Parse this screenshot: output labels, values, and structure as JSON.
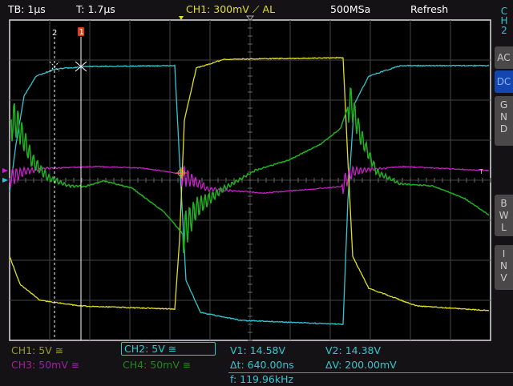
{
  "header": {
    "timebase": "TB: 1µs",
    "trigger_time": "T: 1.7µs",
    "trigger_info": "CH1: 300mV ⟋ AL",
    "sample_rate": "500MSa",
    "mode": "Refresh"
  },
  "side_panel": {
    "channel_label": [
      "C",
      "H",
      "2"
    ],
    "buttons": [
      {
        "label": "AC"
      },
      {
        "label": "DC",
        "active": true
      },
      {
        "label": "G\nN\nD"
      },
      {
        "label": "B\nW\nL"
      },
      {
        "label": "I\nN\nV"
      }
    ]
  },
  "cursors": {
    "cursor1_label": "1",
    "cursor2_label": "2",
    "trigger_marker": "T"
  },
  "channels": {
    "ch1": "CH1: 5V ≅",
    "ch2": "CH2: 5V ≅",
    "ch3": "CH3: 50mV ≅",
    "ch4": "CH4: 50mV ≅"
  },
  "measurements": {
    "v1": "V1: 14.58V",
    "v2": "V2: 14.38V",
    "dt": "Δt: 640.00ns",
    "dv": "ΔV: 200.00mV",
    "f": "f: 119.96kHz"
  },
  "colors": {
    "ch1": "#e0e020",
    "ch2": "#30c8d0",
    "ch3": "#d020d0",
    "ch4": "#20b020",
    "grid": "#555",
    "cursor_flag": "#e04010"
  }
}
